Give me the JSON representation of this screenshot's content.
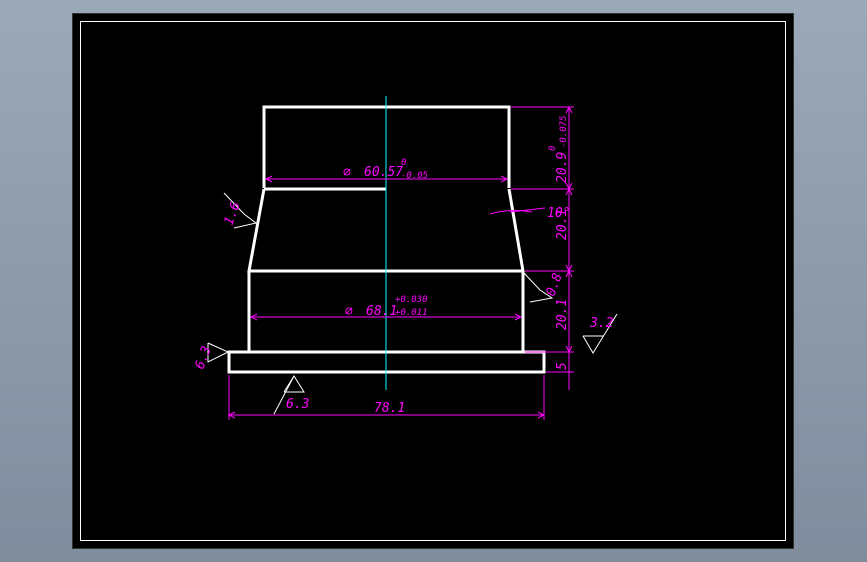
{
  "drawing": {
    "top_diameter": {
      "prefix": "∅ ",
      "value": "60.57",
      "tol_upper": "0",
      "tol_lower": "-0.05"
    },
    "mid_diameter": {
      "prefix": "∅ ",
      "value": "68.1",
      "tol_upper": "+0.030",
      "tol_lower": "+0.011"
    },
    "height_top": {
      "value": "20.9",
      "tol_upper": "0",
      "tol_lower": "-0.075"
    },
    "taper_height": "20.1",
    "taper_angle": "10°",
    "lower_height": "20.1",
    "flange_height": "5",
    "flange_width": "78.1",
    "roughness_taper": "1.6",
    "roughness_right": "0.8",
    "roughness_general": "3.2",
    "roughness_flange_left": "6.3",
    "roughness_flange_bottom": "6.3"
  },
  "colors": {
    "outline": "#ffffff",
    "dimension": "#ff00ff",
    "centerline": "#00ffff",
    "background": "#000000"
  }
}
